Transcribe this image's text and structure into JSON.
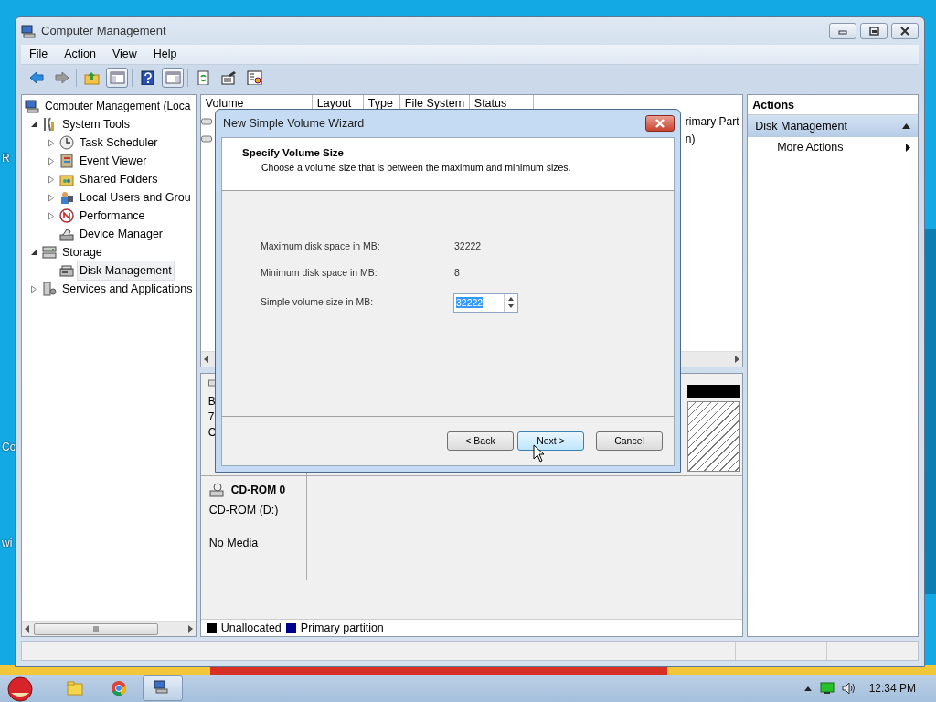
{
  "desktop": {
    "edge_labels": [
      "R",
      "Co",
      "wi"
    ]
  },
  "window": {
    "title": "Computer Management"
  },
  "menu": [
    "File",
    "Action",
    "View",
    "Help"
  ],
  "tree": [
    {
      "label": "Computer Management (Loca",
      "selected": false,
      "children": [
        {
          "label": "System Tools",
          "selected": false,
          "expanded": true,
          "children": [
            {
              "label": "Task Scheduler",
              "selected": false,
              "expanded": false
            },
            {
              "label": "Event Viewer",
              "selected": false,
              "expanded": false
            },
            {
              "label": "Shared Folders",
              "selected": false,
              "expanded": false
            },
            {
              "label": "Local Users and Grou",
              "selected": false,
              "expanded": false
            },
            {
              "label": "Performance",
              "selected": false,
              "expanded": false
            },
            {
              "label": "Device Manager",
              "selected": false
            }
          ]
        },
        {
          "label": "Storage",
          "selected": false,
          "expanded": true,
          "children": [
            {
              "label": "Disk Management",
              "selected": true
            }
          ]
        },
        {
          "label": "Services and Applications",
          "selected": false,
          "expanded": false
        }
      ]
    }
  ],
  "volume_table": {
    "columns": [
      "Volume",
      "Layout",
      "Type",
      "File System",
      "Status"
    ],
    "rows": [
      {
        "status": "rimary Part"
      },
      {
        "status": "n)"
      }
    ]
  },
  "disk_map": {
    "disks": [
      {
        "text_fragments": [
          "B",
          "7",
          "C"
        ]
      },
      {
        "name": "CD-ROM 0",
        "type": "CD-ROM (D:)",
        "status": "No Media"
      }
    ],
    "legend": [
      {
        "label": "Unallocated",
        "color": "#000000"
      },
      {
        "label": "Primary partition",
        "color": "#00008b"
      }
    ]
  },
  "actions": {
    "title": "Actions",
    "section": {
      "label": "Disk Management",
      "expanded": true
    },
    "items": [
      "More Actions"
    ]
  },
  "dialog": {
    "title": "New Simple Volume Wizard",
    "heading": "Specify Volume Size",
    "subheading": "Choose a volume size that is between the maximum and minimum sizes.",
    "fields": [
      {
        "label": "Maximum disk space in MB:",
        "value": "32222",
        "kind": "text"
      },
      {
        "label": "Minimum disk space in MB:",
        "value": "8",
        "kind": "text"
      },
      {
        "label": "Simple volume size in MB:",
        "value": "32222",
        "kind": "spinner"
      }
    ],
    "buttons": [
      {
        "label": "< Back",
        "selected": false
      },
      {
        "label": "Next >",
        "selected": true
      },
      {
        "label": "Cancel",
        "selected": false
      }
    ]
  },
  "taskbar": {
    "apps": [
      {
        "selected": false
      },
      {
        "selected": false
      },
      {
        "selected": true
      }
    ],
    "clock": "12:34 PM"
  }
}
